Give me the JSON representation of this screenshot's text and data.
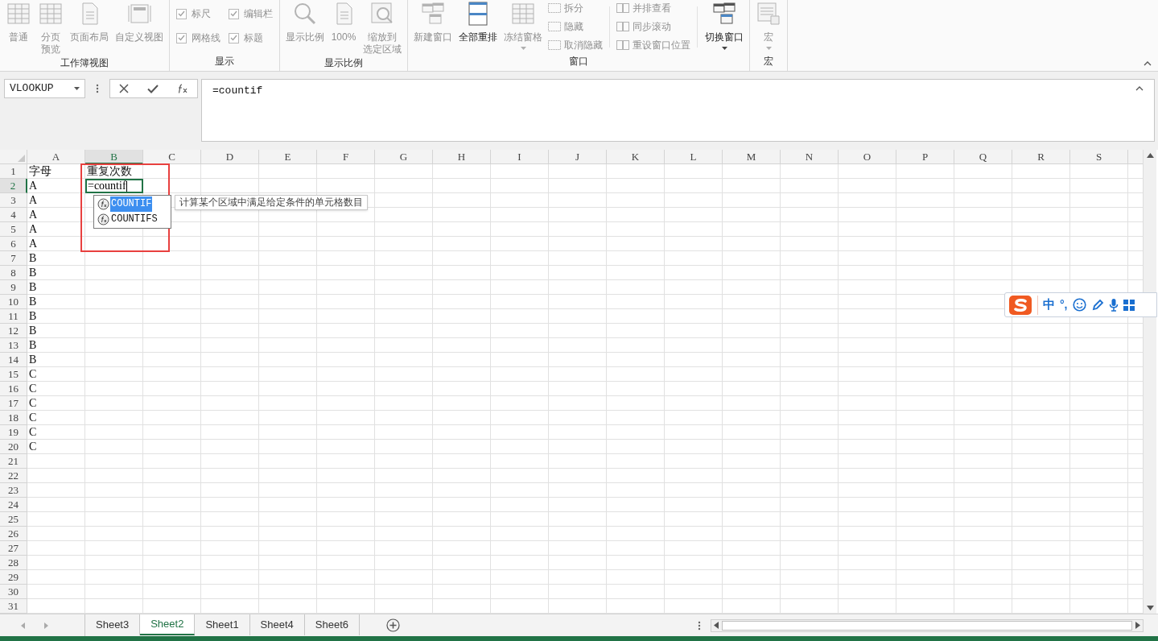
{
  "ribbon": {
    "groups": [
      {
        "label": "工作簿视图",
        "items": [
          {
            "kind": "large",
            "label": "普通",
            "disabled": true
          },
          {
            "kind": "large",
            "label": [
              "分页",
              "预览"
            ],
            "disabled": true
          },
          {
            "kind": "large",
            "label": "页面布局",
            "disabled": true
          },
          {
            "kind": "large",
            "label": "自定义视图",
            "disabled": true
          }
        ]
      },
      {
        "label": "显示",
        "items": [
          {
            "kind": "checkbox",
            "label": "标尺",
            "checked": true,
            "disabled": true
          },
          {
            "kind": "checkbox",
            "label": "网格线",
            "checked": true,
            "disabled": true
          },
          {
            "kind": "checkbox",
            "label": "编辑栏",
            "checked": true,
            "disabled": true
          },
          {
            "kind": "checkbox",
            "label": "标题",
            "checked": true,
            "disabled": true
          }
        ]
      },
      {
        "label": "显示比例",
        "items": [
          {
            "kind": "large",
            "label": "显示比例",
            "disabled": true
          },
          {
            "kind": "large",
            "label": "100%",
            "disabled": true
          },
          {
            "kind": "large",
            "label": [
              "缩放到",
              "选定区域"
            ],
            "disabled": true
          }
        ]
      },
      {
        "label": "窗口",
        "items": [
          {
            "kind": "large",
            "label": "新建窗口",
            "disabled": true
          },
          {
            "kind": "large",
            "label": "全部重排",
            "disabled": false
          },
          {
            "kind": "large",
            "label": "冻结窗格",
            "disabled": true,
            "dropdown": true
          },
          {
            "kind": "small",
            "label": "拆分",
            "disabled": true
          },
          {
            "kind": "small",
            "label": "隐藏",
            "disabled": true
          },
          {
            "kind": "small",
            "label": "取消隐藏",
            "disabled": true
          },
          {
            "kind": "small",
            "label": "并排查看",
            "disabled": true
          },
          {
            "kind": "small",
            "label": "同步滚动",
            "disabled": true
          },
          {
            "kind": "small",
            "label": "重设窗口位置",
            "disabled": true
          },
          {
            "kind": "large",
            "label": "切换窗口",
            "disabled": false,
            "dropdown": true
          }
        ]
      },
      {
        "label": "宏",
        "items": [
          {
            "kind": "large",
            "label": "宏",
            "disabled": true,
            "dropdown": true
          }
        ]
      }
    ]
  },
  "formula_bar": {
    "name_box": "VLOOKUP",
    "formula": "=countif"
  },
  "columns": [
    {
      "label": "A",
      "selected": false
    },
    {
      "label": "B",
      "selected": true
    },
    {
      "label": "C",
      "selected": false
    },
    {
      "label": "D",
      "selected": false
    },
    {
      "label": "E",
      "selected": false
    },
    {
      "label": "F",
      "selected": false
    },
    {
      "label": "G",
      "selected": false
    },
    {
      "label": "H",
      "selected": false
    },
    {
      "label": "I",
      "selected": false
    },
    {
      "label": "J",
      "selected": false
    },
    {
      "label": "K",
      "selected": false
    },
    {
      "label": "L",
      "selected": false
    },
    {
      "label": "M",
      "selected": false
    },
    {
      "label": "N",
      "selected": false
    },
    {
      "label": "O",
      "selected": false
    },
    {
      "label": "P",
      "selected": false
    },
    {
      "label": "Q",
      "selected": false
    },
    {
      "label": "R",
      "selected": false
    },
    {
      "label": "S",
      "selected": false
    }
  ],
  "rows": [
    {
      "header": "1",
      "selected": false,
      "cells": [
        "字母",
        "重复次数"
      ]
    },
    {
      "header": "2",
      "selected": true,
      "cells": [
        "A",
        "=countif"
      ]
    },
    {
      "header": "3",
      "selected": false,
      "cells": [
        "A"
      ]
    },
    {
      "header": "4",
      "selected": false,
      "cells": [
        "A"
      ]
    },
    {
      "header": "5",
      "selected": false,
      "cells": [
        "A"
      ]
    },
    {
      "header": "6",
      "selected": false,
      "cells": [
        "A"
      ]
    },
    {
      "header": "7",
      "selected": false,
      "cells": [
        "B"
      ]
    },
    {
      "header": "8",
      "selected": false,
      "cells": [
        "B"
      ]
    },
    {
      "header": "9",
      "selected": false,
      "cells": [
        "B"
      ]
    },
    {
      "header": "10",
      "selected": false,
      "cells": [
        "B"
      ]
    },
    {
      "header": "11",
      "selected": false,
      "cells": [
        "B"
      ]
    },
    {
      "header": "12",
      "selected": false,
      "cells": [
        "B"
      ]
    },
    {
      "header": "13",
      "selected": false,
      "cells": [
        "B"
      ]
    },
    {
      "header": "14",
      "selected": false,
      "cells": [
        "B"
      ]
    },
    {
      "header": "15",
      "selected": false,
      "cells": [
        "C"
      ]
    },
    {
      "header": "16",
      "selected": false,
      "cells": [
        "C"
      ]
    },
    {
      "header": "17",
      "selected": false,
      "cells": [
        "C"
      ]
    },
    {
      "header": "18",
      "selected": false,
      "cells": [
        "C"
      ]
    },
    {
      "header": "19",
      "selected": false,
      "cells": [
        "C"
      ]
    },
    {
      "header": "20",
      "selected": false,
      "cells": [
        "C"
      ]
    },
    {
      "header": "21",
      "selected": false
    },
    {
      "header": "22",
      "selected": false
    },
    {
      "header": "23",
      "selected": false
    },
    {
      "header": "24",
      "selected": false
    },
    {
      "header": "25",
      "selected": false
    },
    {
      "header": "26",
      "selected": false
    },
    {
      "header": "27",
      "selected": false
    },
    {
      "header": "28",
      "selected": false
    },
    {
      "header": "29",
      "selected": false
    },
    {
      "header": "30",
      "selected": false
    },
    {
      "header": "31",
      "selected": false
    }
  ],
  "autocomplete": {
    "items": [
      {
        "label": "COUNTIF",
        "selected": true
      },
      {
        "label": "COUNTIFS",
        "selected": false
      }
    ],
    "tooltip": "计算某个区域中满足给定条件的单元格数目"
  },
  "ime_toolbar": {
    "mode": "中",
    "punctuation": "°,"
  },
  "sheet_tabs": [
    {
      "label": "Sheet3",
      "selected": false
    },
    {
      "label": "Sheet2",
      "selected": true
    },
    {
      "label": "Sheet1",
      "selected": false
    },
    {
      "label": "Sheet4",
      "selected": false
    },
    {
      "label": "Sheet6",
      "selected": false
    }
  ]
}
